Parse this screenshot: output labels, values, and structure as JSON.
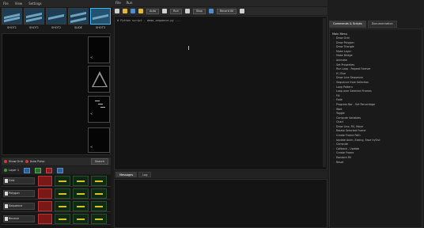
{
  "left_pane": {
    "menu": [
      "File",
      "View",
      "Settings"
    ],
    "thumbnails": [
      "SHOT1",
      "SHOT1",
      "SHOT2",
      "SLIDE",
      "SHOT3"
    ],
    "active_thumbnail": 4,
    "frame_dashes": [
      "—",
      "—",
      "—"
    ],
    "toolbar": {
      "check1": "Show Grid",
      "check2": "Auto Pulse",
      "search_button": "Search"
    },
    "sub_label": "Layer 1",
    "tracks": [
      "Grid",
      "Polygon",
      "Sequence",
      "Bounce"
    ]
  },
  "middle_pane": {
    "menu": [
      "File",
      "Run"
    ],
    "toolbar_selects": [
      "Auto",
      "Run",
      "Stop",
      "Record All"
    ],
    "editor_line": "# Python script - demo_sequence.py   ...",
    "console_tabs": [
      "Messages",
      "Log"
    ]
  },
  "right_pane": {
    "tabs": [
      "Commands & Scripts",
      "Documentation"
    ],
    "list_header": "Main Menu",
    "items": [
      "Draw Grid",
      "Draw Polygon",
      "Draw Triangle",
      "Make Layer",
      "Make Bridge",
      "Animate",
      "Set Properties",
      "Run Loop - Repeat Forever",
      "If / Else",
      "Draw Line Sequence",
      "Sequence from Selection",
      "Loop Pattern",
      "Loop over Selected Frames",
      "Fill",
      "Fade",
      "Progress Bar - Set Percentage",
      "Wait",
      "Toggle",
      "Compute Variables",
      "Chart",
      "Draw Line, Fill, Move",
      "Rotate Selected Frame",
      "Create Frame Path",
      "Update Anim, Easing, Ease In/Out",
      "Compute",
      "Callback - Update",
      "Create Frame",
      "Random Fill",
      "Reset"
    ]
  }
}
